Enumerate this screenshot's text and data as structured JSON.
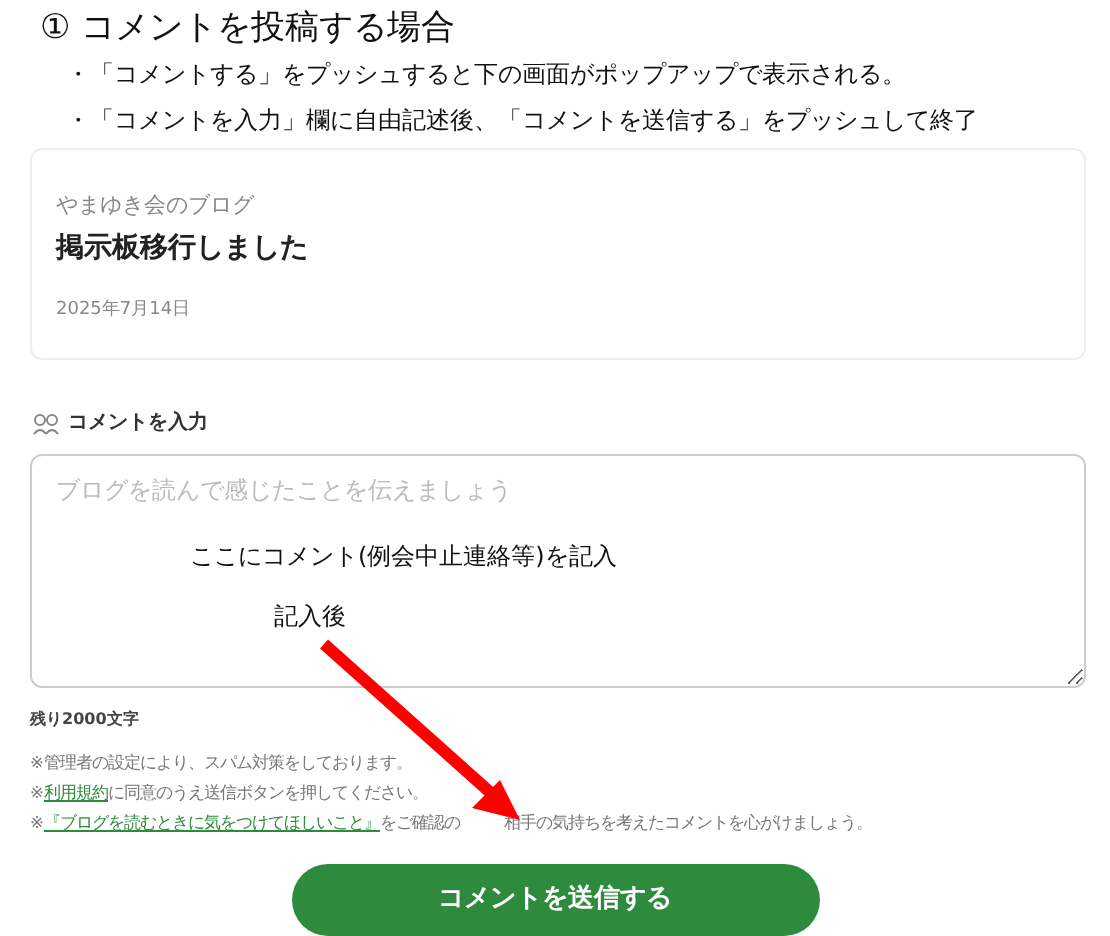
{
  "heading": "① コメントを投稿する場合",
  "instructions": [
    "・「コメントする」をプッシュすると下の画面がポップアップで表示される。",
    "・「コメントを入力」欄に自由記述後、「コメントを送信する」をプッシュして終了"
  ],
  "post_card": {
    "blog_name": "やまゆき会のブログ",
    "title": "掲示板移行しました",
    "date": "2025年7月14日"
  },
  "comment_section": {
    "label": "コメントを入力",
    "placeholder": "ブログを読んで感じたことを伝えましょう",
    "remaining": "残り2000文字"
  },
  "annotations": [
    "ここにコメント(例会中止連絡等)を記入",
    "記入後"
  ],
  "notes": [
    [
      {
        "kind": "text",
        "text": "※管理者の設定により、スパム対策をしております。"
      }
    ],
    [
      {
        "kind": "text",
        "text": "※"
      },
      {
        "kind": "link",
        "text": "利用規約"
      },
      {
        "kind": "text",
        "text": "に同意のうえ送信ボタンを押してください。"
      }
    ],
    [
      {
        "kind": "text",
        "text": "※"
      },
      {
        "kind": "link",
        "text": "『ブログを読むときに気をつけてほしいこと』"
      },
      {
        "kind": "text",
        "text": "をご確認の"
      },
      {
        "kind": "covered"
      },
      {
        "kind": "text",
        "text": "相手の気持ちを考えたコメントを心がけましょう。"
      }
    ]
  ],
  "submit_button": "コメントを送信する"
}
